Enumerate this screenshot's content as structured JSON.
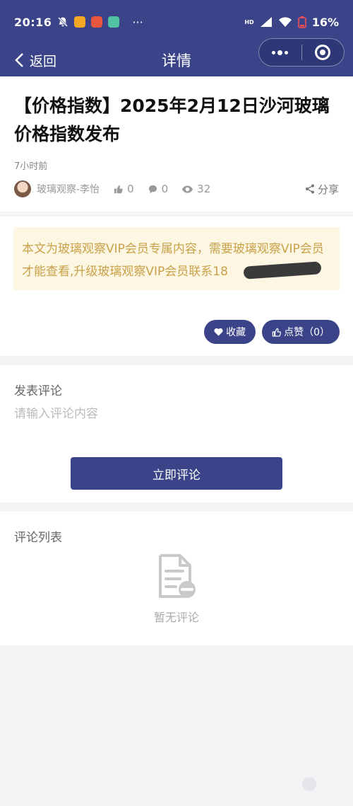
{
  "status": {
    "time": "20:16",
    "more": "···",
    "network": "HD",
    "battery": "16%"
  },
  "nav": {
    "back_label": "返回",
    "title": "详情",
    "capsule_more_icon": "more-dots-icon",
    "capsule_close_icon": "target-icon"
  },
  "article": {
    "title": "【价格指数】2025年2月12日沙河玻璃价格指数发布",
    "time": "7小时前",
    "author": "玻璃观察-李怡",
    "likes": "0",
    "comments": "0",
    "views": "32",
    "share_label": "分享"
  },
  "notice": {
    "text": "本文为玻璃观察VIP会员专属内容，需要玻璃观察VIP会员才能查看,升级玻璃观察VIP会员联系18"
  },
  "actions": {
    "favorite_label": "收藏",
    "like_label": "点赞（0）"
  },
  "comment": {
    "section_label": "发表评论",
    "placeholder": "请输入评论内容",
    "submit_label": "立即评论"
  },
  "comment_list": {
    "section_label": "评论列表",
    "empty_text": "暂无评论"
  },
  "colors": {
    "primary": "#3b4488",
    "notice_bg": "#fdf6e2",
    "notice_text": "#c9a14a",
    "page_bg": "#f3f4f6"
  }
}
